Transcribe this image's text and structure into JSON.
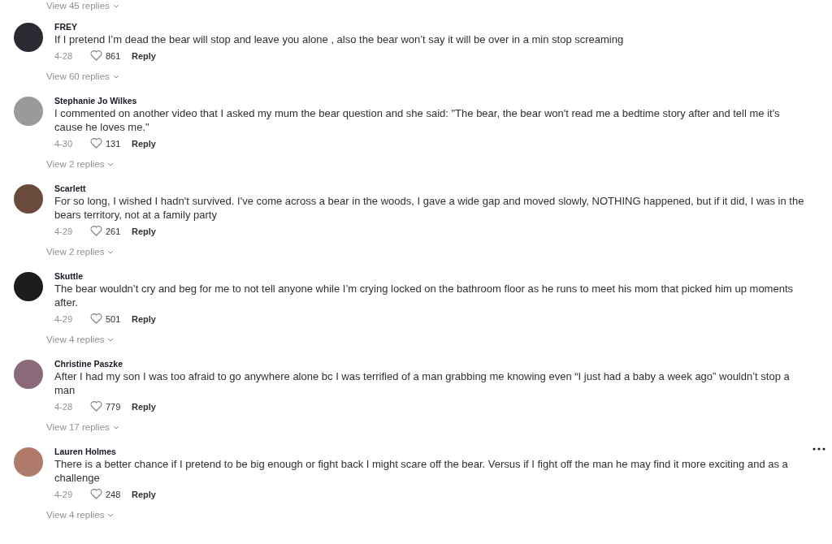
{
  "top_replies": {
    "label": "View 45 replies"
  },
  "comments": [
    {
      "author": "FREY",
      "text": "If I pretend I’m dead the bear will stop and leave you alone , also the bear won’t say it will be over in a min stop screaming",
      "date": "4-28",
      "likes": "861",
      "reply": "Reply",
      "view_replies": "View 60 replies",
      "more_button": false
    },
    {
      "author": "Stephanie Jo Wilkes",
      "text": "I commented on another video that I asked my mum the bear question and she said: \"The bear, the bear won't read me a bedtime story after and tell me it's cause he loves me.\"",
      "date": "4-30",
      "likes": "131",
      "reply": "Reply",
      "view_replies": "View 2 replies",
      "more_button": false
    },
    {
      "author": "Scarlett",
      "text": "For so long, I wished I hadn't survived. I've come across a bear in the woods, I gave a wide gap and moved slowly, NOTHING happened, but if it did, I was in the bears territory, not at a family party",
      "date": "4-29",
      "likes": "261",
      "reply": "Reply",
      "view_replies": "View 2 replies",
      "more_button": false
    },
    {
      "author": "Skuttle",
      "text": "The bear wouldn’t cry and beg for me to not tell anyone while I’m crying locked on the bathroom floor as he runs to meet his mom that picked him up moments after.",
      "date": "4-29",
      "likes": "501",
      "reply": "Reply",
      "view_replies": "View 4 replies",
      "more_button": false
    },
    {
      "author": "Christine Paszke",
      "text": "After I had my son I was too afraid to go anywhere alone bc I was terrified of a man grabbing me knowing even “I just had a baby a week ago” wouldn’t stop a man",
      "date": "4-28",
      "likes": "779",
      "reply": "Reply",
      "view_replies": "View 17 replies",
      "more_button": false
    },
    {
      "author": "Lauren Holmes",
      "text": "There is a better chance if I pretend to be big enough or fight back I might scare off the bear. Versus if I fight off the man he may find it more exciting and as a challenge",
      "date": "4-29",
      "likes": "248",
      "reply": "Reply",
      "view_replies": "View 4 replies",
      "more_button": true
    }
  ]
}
